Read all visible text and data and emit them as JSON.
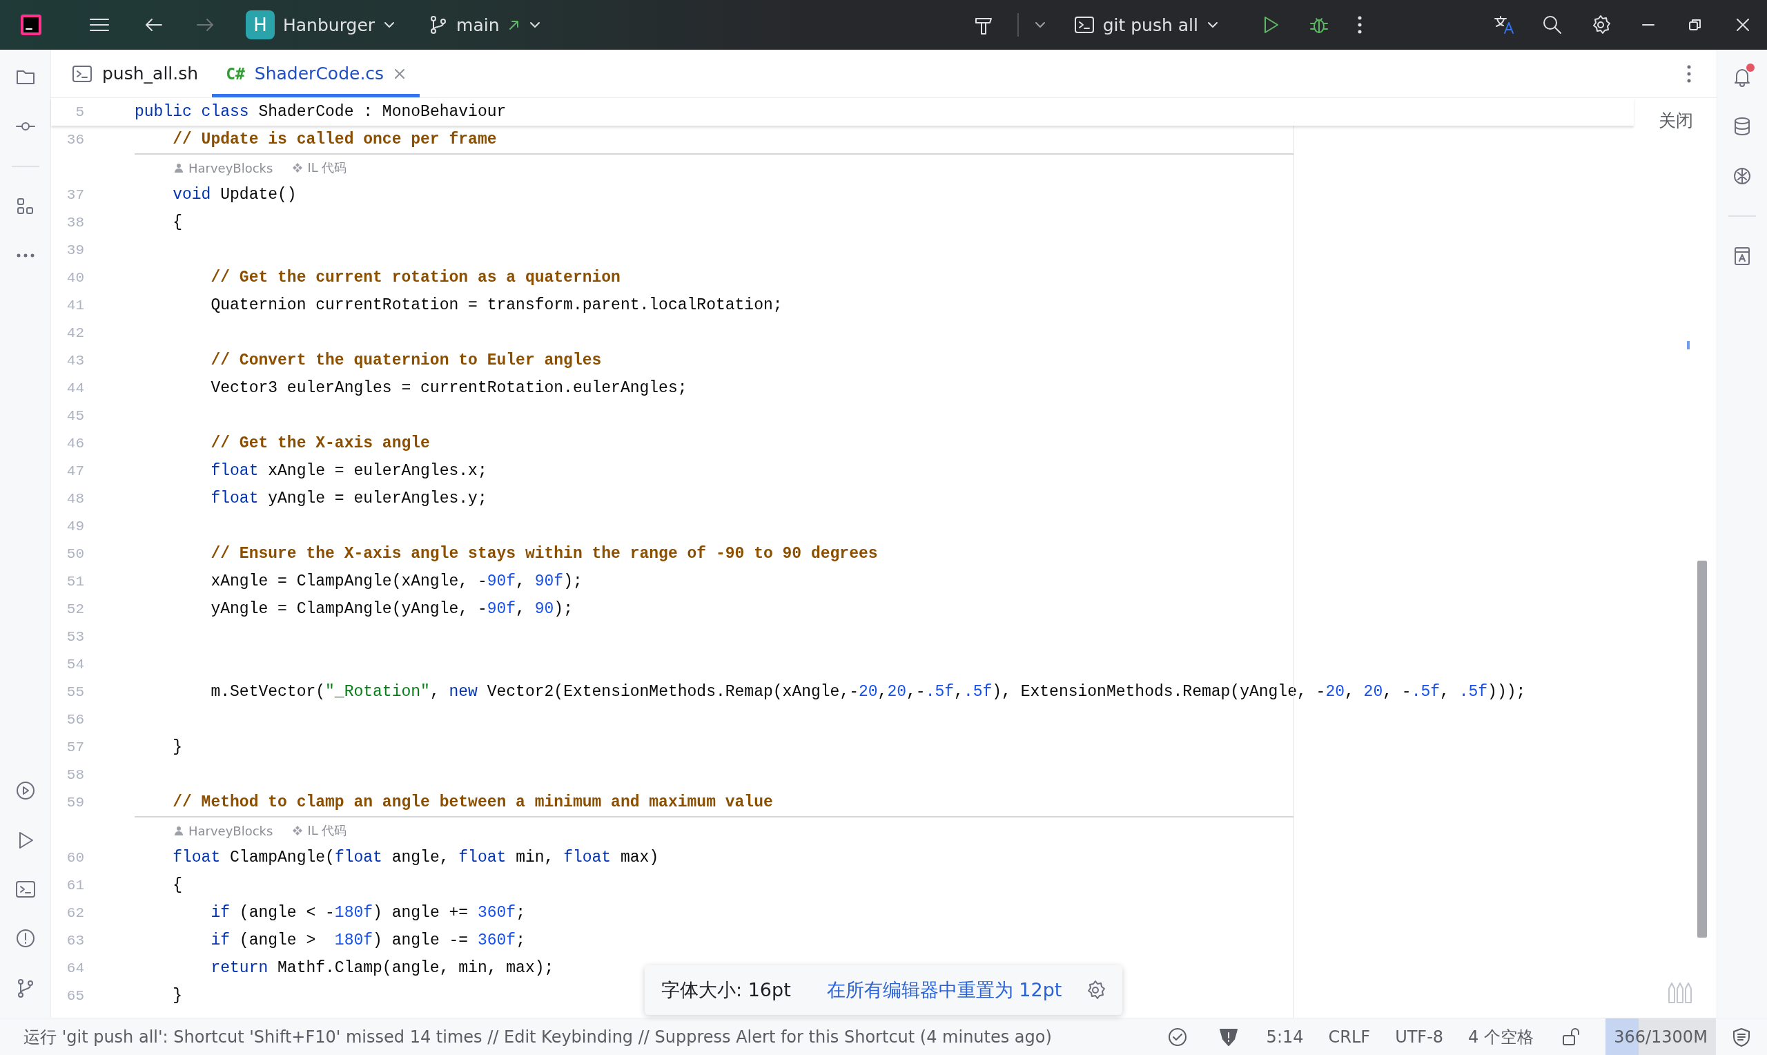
{
  "title_bar": {
    "project": {
      "initial": "H",
      "name": "Hanburger"
    },
    "branch": {
      "name": "main"
    },
    "navigation": {
      "back_disabled": false,
      "forward_disabled": true
    },
    "run_config": {
      "name": "git push all"
    }
  },
  "tabs": [
    {
      "label": "push_all.sh",
      "kind": "shell",
      "selected": false
    },
    {
      "label": "ShaderCode.cs",
      "kind": "csharp",
      "lang_badge": "C#",
      "selected": true
    }
  ],
  "notifications": {
    "unread": true
  },
  "sticky_line": {
    "number": "5",
    "segments": [
      {
        "kind": "keyword",
        "text": "public class"
      },
      {
        "kind": "plain",
        "text": " ShaderCode : MonoBehaviour"
      }
    ]
  },
  "close_hint": "关闭",
  "lines": [
    {
      "kind": "code",
      "number": "36",
      "segments": [
        {
          "kind": "comment",
          "text": "    // Update is called once per frame"
        }
      ]
    },
    {
      "kind": "hint",
      "items": [
        {
          "kind": "author",
          "text": "HarveyBlocks"
        },
        {
          "kind": "il",
          "text": "IL 代码"
        }
      ]
    },
    {
      "kind": "code",
      "number": "37",
      "segments": [
        {
          "kind": "keyword",
          "text": "    void"
        },
        {
          "kind": "plain",
          "text": " Update()"
        }
      ]
    },
    {
      "kind": "code",
      "number": "38",
      "segments": [
        {
          "kind": "plain",
          "text": "    {"
        }
      ]
    },
    {
      "kind": "code",
      "number": "39"
    },
    {
      "kind": "code",
      "number": "40",
      "segments": [
        {
          "kind": "comment",
          "text": "        // Get the current rotation as a quaternion"
        }
      ]
    },
    {
      "kind": "code",
      "number": "41",
      "segments": [
        {
          "kind": "plain",
          "text": "        Quaternion currentRotation = transform.parent.localRotation;"
        }
      ]
    },
    {
      "kind": "code",
      "number": "42"
    },
    {
      "kind": "code",
      "number": "43",
      "segments": [
        {
          "kind": "comment",
          "text": "        // Convert the quaternion to Euler angles"
        }
      ]
    },
    {
      "kind": "code",
      "number": "44",
      "segments": [
        {
          "kind": "plain",
          "text": "        Vector3 eulerAngles = currentRotation.eulerAngles;"
        }
      ]
    },
    {
      "kind": "code",
      "number": "45"
    },
    {
      "kind": "code",
      "number": "46",
      "segments": [
        {
          "kind": "comment",
          "text": "        // Get the X-axis angle"
        }
      ]
    },
    {
      "kind": "code",
      "number": "47",
      "segments": [
        {
          "kind": "keyword",
          "text": "        float"
        },
        {
          "kind": "plain",
          "text": " xAngle = eulerAngles.x;"
        }
      ]
    },
    {
      "kind": "code",
      "number": "48",
      "segments": [
        {
          "kind": "keyword",
          "text": "        float"
        },
        {
          "kind": "plain",
          "text": " yAngle = eulerAngles.y;"
        }
      ]
    },
    {
      "kind": "code",
      "number": "49"
    },
    {
      "kind": "code",
      "number": "50",
      "segments": [
        {
          "kind": "comment",
          "text": "        // Ensure the X-axis angle stays within the range of -90 to 90 degrees"
        }
      ]
    },
    {
      "kind": "code",
      "number": "51",
      "segments": [
        {
          "kind": "plain",
          "text": "        xAngle = ClampAngle(xAngle, -"
        },
        {
          "kind": "number",
          "text": "90f"
        },
        {
          "kind": "plain",
          "text": ", "
        },
        {
          "kind": "number",
          "text": "90f"
        },
        {
          "kind": "plain",
          "text": ");"
        }
      ]
    },
    {
      "kind": "code",
      "number": "52",
      "segments": [
        {
          "kind": "plain",
          "text": "        yAngle = ClampAngle(yAngle, -"
        },
        {
          "kind": "number",
          "text": "90f"
        },
        {
          "kind": "plain",
          "text": ", "
        },
        {
          "kind": "number",
          "text": "90"
        },
        {
          "kind": "plain",
          "text": ");"
        }
      ]
    },
    {
      "kind": "code",
      "number": "53"
    },
    {
      "kind": "code",
      "number": "54"
    },
    {
      "kind": "code",
      "number": "55",
      "segments": [
        {
          "kind": "plain",
          "text": "        m.SetVector("
        },
        {
          "kind": "string",
          "text": "\"_Rotation\""
        },
        {
          "kind": "plain",
          "text": ", "
        },
        {
          "kind": "keyword",
          "text": "new"
        },
        {
          "kind": "plain",
          "text": " Vector2(ExtensionMethods.Remap(xAngle,-"
        },
        {
          "kind": "number",
          "text": "20"
        },
        {
          "kind": "plain",
          "text": ","
        },
        {
          "kind": "number",
          "text": "20"
        },
        {
          "kind": "plain",
          "text": ",-"
        },
        {
          "kind": "number",
          "text": ".5f"
        },
        {
          "kind": "plain",
          "text": ","
        },
        {
          "kind": "number",
          "text": ".5f"
        },
        {
          "kind": "plain",
          "text": "), ExtensionMethods.Remap(yAngle, -"
        },
        {
          "kind": "number",
          "text": "20"
        },
        {
          "kind": "plain",
          "text": ", "
        },
        {
          "kind": "number",
          "text": "20"
        },
        {
          "kind": "plain",
          "text": ", -"
        },
        {
          "kind": "number",
          "text": ".5f"
        },
        {
          "kind": "plain",
          "text": ", "
        },
        {
          "kind": "number",
          "text": ".5f"
        },
        {
          "kind": "plain",
          "text": ")));"
        }
      ]
    },
    {
      "kind": "code",
      "number": "56"
    },
    {
      "kind": "code",
      "number": "57",
      "segments": [
        {
          "kind": "plain",
          "text": "    }"
        }
      ]
    },
    {
      "kind": "code",
      "number": "58"
    },
    {
      "kind": "code",
      "number": "59",
      "segments": [
        {
          "kind": "comment",
          "text": "    // Method to clamp an angle between a minimum and maximum value"
        }
      ]
    },
    {
      "kind": "hint",
      "items": [
        {
          "kind": "author",
          "text": "HarveyBlocks"
        },
        {
          "kind": "il",
          "text": "IL 代码"
        }
      ]
    },
    {
      "kind": "code",
      "number": "60",
      "segments": [
        {
          "kind": "keyword",
          "text": "    float"
        },
        {
          "kind": "plain",
          "text": " ClampAngle("
        },
        {
          "kind": "keyword",
          "text": "float"
        },
        {
          "kind": "plain",
          "text": " angle, "
        },
        {
          "kind": "keyword",
          "text": "float"
        },
        {
          "kind": "plain",
          "text": " min, "
        },
        {
          "kind": "keyword",
          "text": "float"
        },
        {
          "kind": "plain",
          "text": " max)"
        }
      ]
    },
    {
      "kind": "code",
      "number": "61",
      "segments": [
        {
          "kind": "plain",
          "text": "    {"
        }
      ]
    },
    {
      "kind": "code",
      "number": "62",
      "segments": [
        {
          "kind": "keyword",
          "text": "        if"
        },
        {
          "kind": "plain",
          "text": " (angle < -"
        },
        {
          "kind": "number",
          "text": "180f"
        },
        {
          "kind": "plain",
          "text": ") angle += "
        },
        {
          "kind": "number",
          "text": "360f"
        },
        {
          "kind": "plain",
          "text": ";"
        }
      ]
    },
    {
      "kind": "code",
      "number": "63",
      "segments": [
        {
          "kind": "keyword",
          "text": "        if"
        },
        {
          "kind": "plain",
          "text": " (angle >  "
        },
        {
          "kind": "number",
          "text": "180f"
        },
        {
          "kind": "plain",
          "text": ") angle -= "
        },
        {
          "kind": "number",
          "text": "360f"
        },
        {
          "kind": "plain",
          "text": ";"
        }
      ]
    },
    {
      "kind": "code",
      "number": "64",
      "segments": [
        {
          "kind": "keyword",
          "text": "        return"
        },
        {
          "kind": "plain",
          "text": " Mathf.Clamp(angle, min, max);"
        }
      ]
    },
    {
      "kind": "code",
      "number": "65",
      "segments": [
        {
          "kind": "plain",
          "text": "    }"
        }
      ]
    }
  ],
  "font_popup": {
    "label": "字体大小: 16pt",
    "link": "在所有编辑器中重置为 12pt"
  },
  "status_bar": {
    "message": "运行 'git push all': Shortcut 'Shift+F10' missed 14 times // Edit Keybinding // Suppress Alert for this Shortcut (4 minutes ago)",
    "position": "5:14",
    "line_separator": "CRLF",
    "encoding": "UTF-8",
    "indent": "4 个空格",
    "memory": {
      "text": "366/1300M",
      "level": 0.3
    }
  }
}
